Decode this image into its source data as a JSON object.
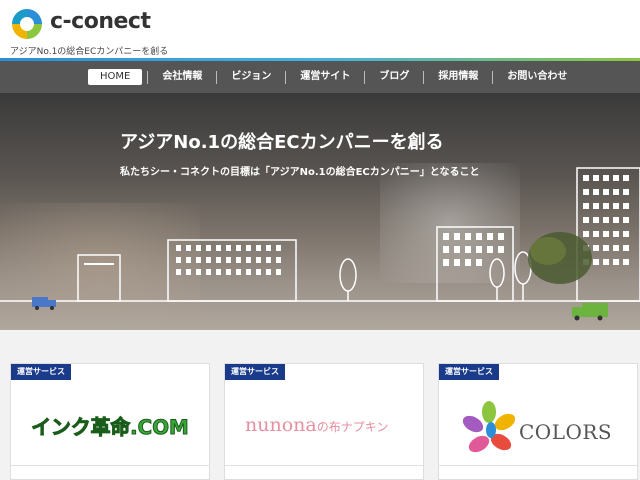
{
  "header": {
    "brand": "c-conect",
    "tagline": "アジアNo.1の総合ECカンパニーを創る"
  },
  "nav": {
    "items": [
      "HOME",
      "会社情報",
      "ビジョン",
      "運営サイト",
      "ブログ",
      "採用情報",
      "お問い合わせ"
    ],
    "active": "HOME"
  },
  "hero": {
    "title": "アジアNo.1の総合ECカンパニーを創る",
    "subtitle": "私たちシー・コネクトの目標は「アジアNo.1の総合ECカンパニー」となること"
  },
  "cards": [
    {
      "badge": "運営サービス",
      "logo_text": "インク革命.COM"
    },
    {
      "badge": "運営サービス",
      "logo_text": "nunona",
      "logo_suffix": "の布ナプキン"
    },
    {
      "badge": "運営サービス",
      "logo_text": "COLORS"
    }
  ],
  "colors": {
    "nav_bg": "#555555",
    "badge_bg": "#1a3a8a",
    "ink_green": "#3aa63a",
    "nunona_pink": "#e58fa0"
  }
}
